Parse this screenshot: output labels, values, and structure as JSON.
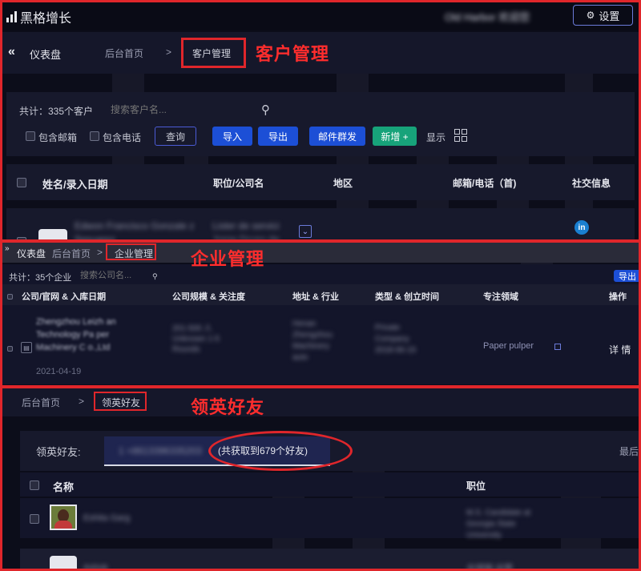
{
  "app": {
    "logo_text": "黑格增长",
    "user_name": "Old Harbor 欢迎您",
    "settings_label": "设置"
  },
  "section1": {
    "nav": {
      "dashboard": "仪表盘",
      "home_tab": "后台首页",
      "sep": ">",
      "active_tab": "客户管理"
    },
    "annotation": "客户管理",
    "stats": "共计：335个客户",
    "search_placeholder": "搜索客户名...",
    "filters": [
      "包含邮箱",
      "包含电话"
    ],
    "query_label": "查询",
    "buttons": [
      "导入",
      "导出",
      "邮件群发",
      "新增 +"
    ],
    "display_label": "显示",
    "columns": [
      "姓名/录入日期",
      "职位/公司名",
      "地区",
      "邮箱/电话（首)",
      "社交信息"
    ],
    "row": {
      "name": "Edwon Francisco Gonzale z Sesuarez",
      "company": "Lister de servici Jorge Grupo de Solucion a",
      "social": "in"
    }
  },
  "section2": {
    "nav": {
      "dashboard": "仪表盘",
      "home_tab": "后台首页",
      "sep": ">",
      "active_tab": "企业管理"
    },
    "annotation": "企业管理",
    "stats": "共计：35个企业",
    "search_placeholder": "搜索公司名...",
    "export_label": "导出",
    "columns": [
      "公司/官网 & 入库日期",
      "公司规模 & 关注度",
      "地址 & 行业",
      "类型 & 创立时间",
      "专注领域",
      "操作"
    ],
    "row": {
      "company": "Zhengzhou Leizh an Technology Pa per Machinery C o.,Ltd",
      "date": "2021-04-19",
      "scale": "201-500 人 Unknown 1-5 Rounds",
      "address": "Henan Zhengzhou Machinery auto",
      "type": "Private Company 2018-06-15",
      "focus": "Paper pulper",
      "action": "详 情"
    }
  },
  "section3": {
    "nav": {
      "home_tab": "后台首页",
      "sep": ">",
      "active_tab": "领英好友"
    },
    "annotation": "领英好友",
    "friends_label": "领英好友:",
    "account": "1 +8613396335203",
    "count_text": "(共获取到679个好友)",
    "latest": "最后",
    "columns": [
      "名称",
      "职位"
    ],
    "rows": [
      {
        "name": "Eshita Garg",
        "title": "M.S. Candidate at Georgia State University"
      },
      {
        "name": "Ashok",
        "title": "全球销 运营"
      }
    ]
  }
}
